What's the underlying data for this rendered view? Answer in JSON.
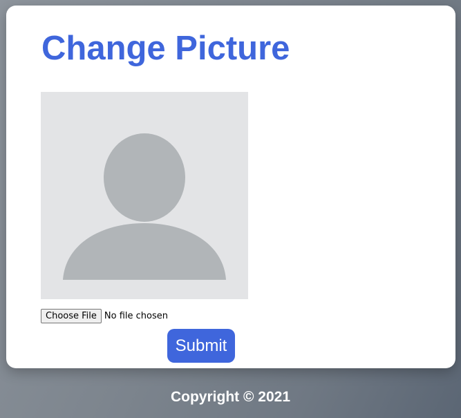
{
  "page": {
    "title": "Change Picture"
  },
  "avatar": {
    "icon": "default-user-silhouette-icon",
    "background_color": "#e3e4e6",
    "silhouette_color": "#b1b5b8"
  },
  "file_input": {
    "button_label": "Choose File",
    "status_text": "No file chosen"
  },
  "form": {
    "submit_label": "Submit"
  },
  "footer": {
    "copyright": "Copyright © 2021"
  },
  "colors": {
    "accent": "#3f66dc",
    "card_background": "#ffffff"
  }
}
